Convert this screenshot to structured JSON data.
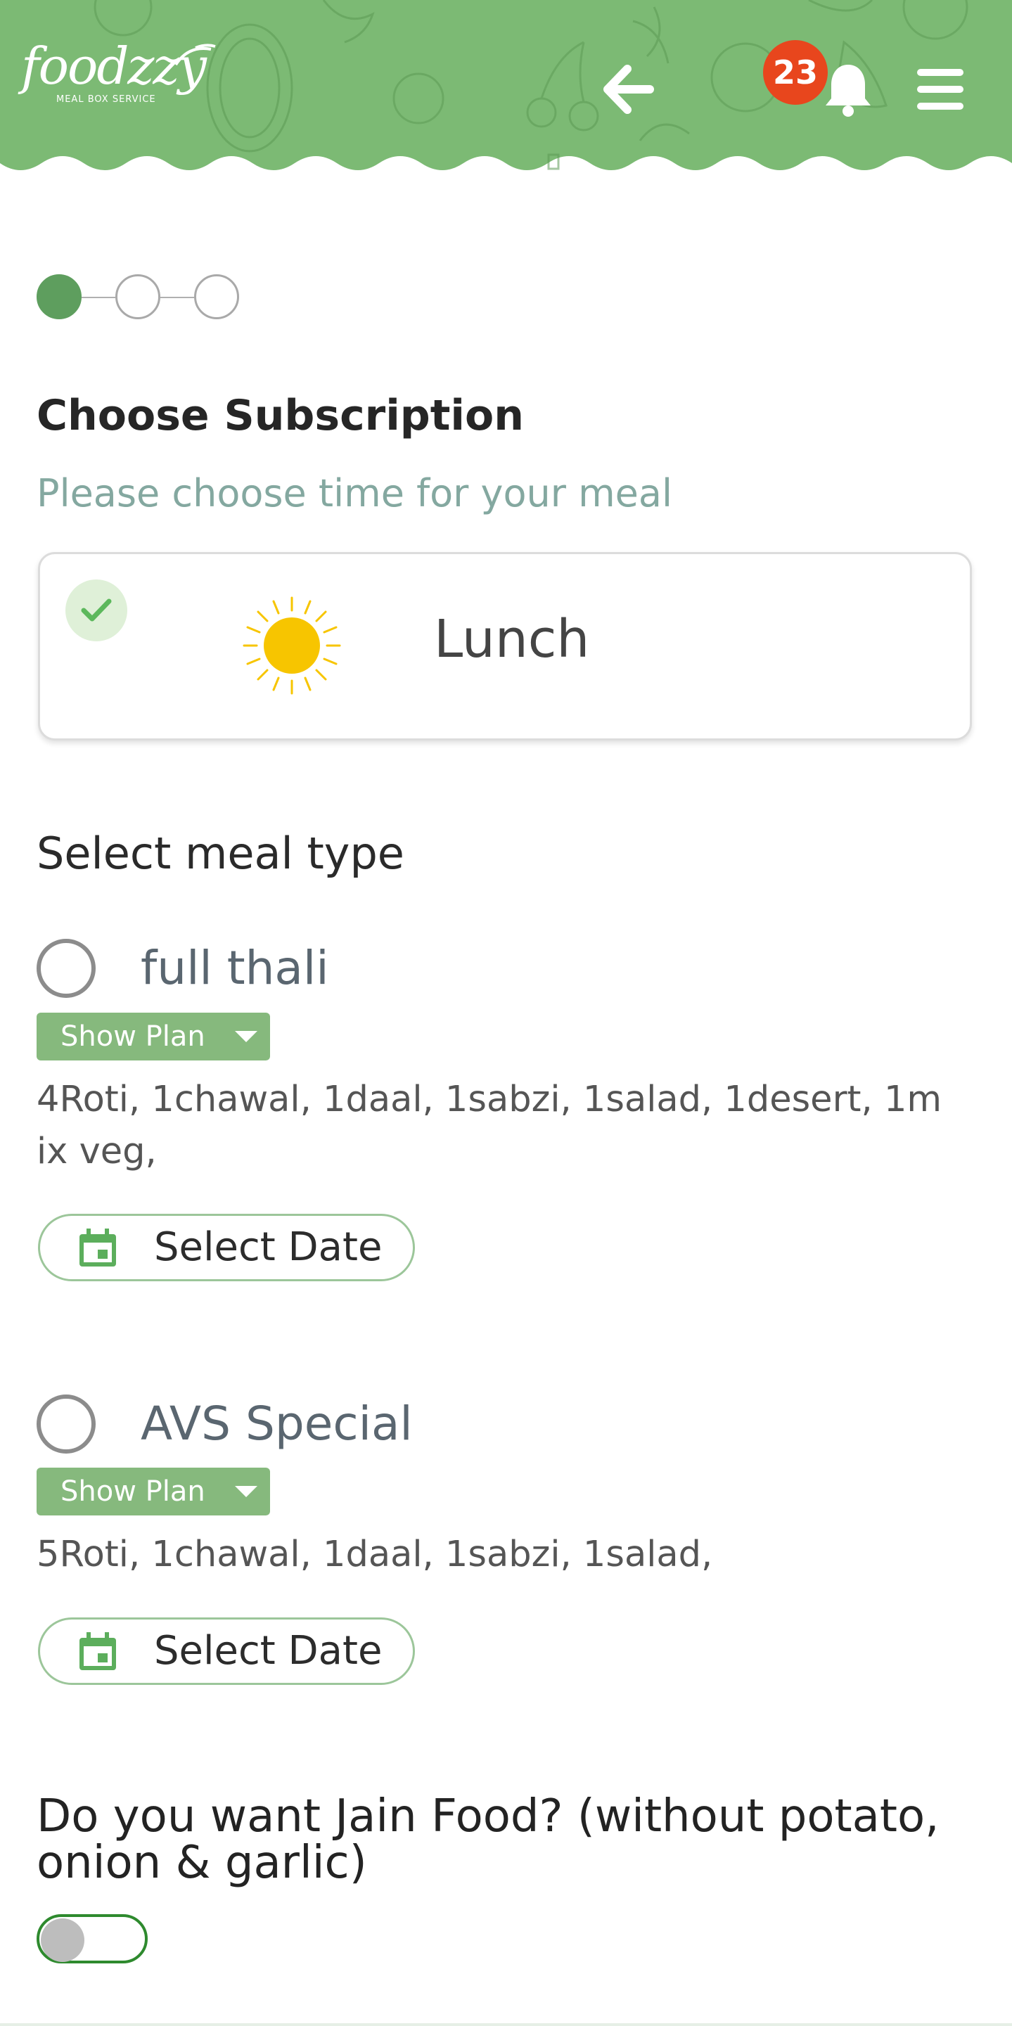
{
  "header": {
    "logo_text": "foodzzy",
    "logo_tagline": "MEAL BOX SERVICE",
    "notification_count": "23",
    "back_icon": "arrow-left-icon",
    "bell_icon": "bell-icon",
    "menu_icon": "hamburger-menu-icon",
    "bg_color": "#7cba74"
  },
  "stepper": {
    "total_steps": 3,
    "current_step": 1
  },
  "subscription": {
    "title": "Choose Subscription",
    "subtitle": "Please choose time for your meal",
    "meal_time": {
      "label": "Lunch",
      "icon": "sun-icon",
      "selected": true
    }
  },
  "meal_type": {
    "section_title": "Select meal type",
    "options": [
      {
        "name": "full thali",
        "show_plan_label": "Show Plan",
        "description": "4Roti, 1chawal, 1daal, 1sabzi, 1salad, 1desert, 1mix veg,",
        "select_date_label": "Select Date",
        "selected": false
      },
      {
        "name": "AVS Special",
        "show_plan_label": "Show Plan",
        "description": "5Roti, 1chawal, 1daal, 1sabzi, 1salad,",
        "select_date_label": "Select Date",
        "selected": false
      }
    ]
  },
  "jain_food": {
    "question": "Do you want Jain Food? (without potato, onion & garlic)",
    "enabled": false
  },
  "colors": {
    "accent_green": "#5e9e5e",
    "button_green": "#86b97d",
    "badge_red": "#e8461d",
    "subtitle_teal": "#84a8a0"
  }
}
